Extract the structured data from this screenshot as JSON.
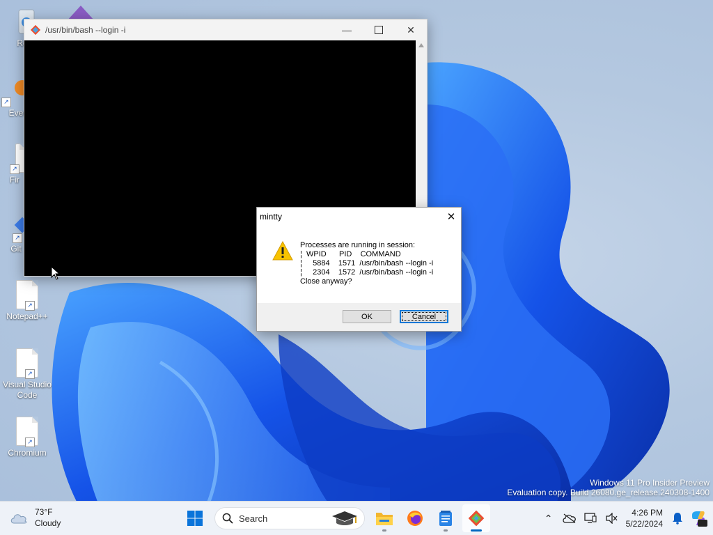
{
  "desktop": {
    "icons": [
      {
        "label": "Recy"
      },
      {
        "label": "Ever"
      },
      {
        "label": "Fir"
      },
      {
        "label": "Git"
      },
      {
        "label": "Notepad++"
      },
      {
        "label": "Visual Studio Code"
      },
      {
        "label": "Chromium"
      }
    ],
    "watermark": {
      "line1": "Windows 11 Pro Insider Preview",
      "line2": "Evaluation copy. Build 26080.ge_release.240308-1400"
    }
  },
  "terminal": {
    "title": "/usr/bin/bash --login -i",
    "minimize_icon": "minimize-icon",
    "maximize_icon": "maximize-icon",
    "close_icon": "close-icon"
  },
  "dialog": {
    "title": "mintty",
    "icon": "warning-icon",
    "message": "Processes are running in session:\n¦  WPID      PID    COMMAND\n¦     5884    1571  /usr/bin/bash --login -i\n¦     2304    1572  /usr/bin/bash --login -i\nClose anyway?",
    "ok_label": "OK",
    "cancel_label": "Cancel"
  },
  "taskbar": {
    "weather": {
      "temp": "73°F",
      "condition": "Cloudy"
    },
    "search_label": "Search",
    "apps": [
      "start",
      "search",
      "file-explorer",
      "firefox",
      "notepad",
      "git-bash"
    ],
    "clock": {
      "time": "4:26 PM",
      "date": "5/22/2024"
    }
  },
  "colors": {
    "accent": "#0067c0",
    "terminal_bg": "#000000",
    "warning": "#f8c300"
  }
}
